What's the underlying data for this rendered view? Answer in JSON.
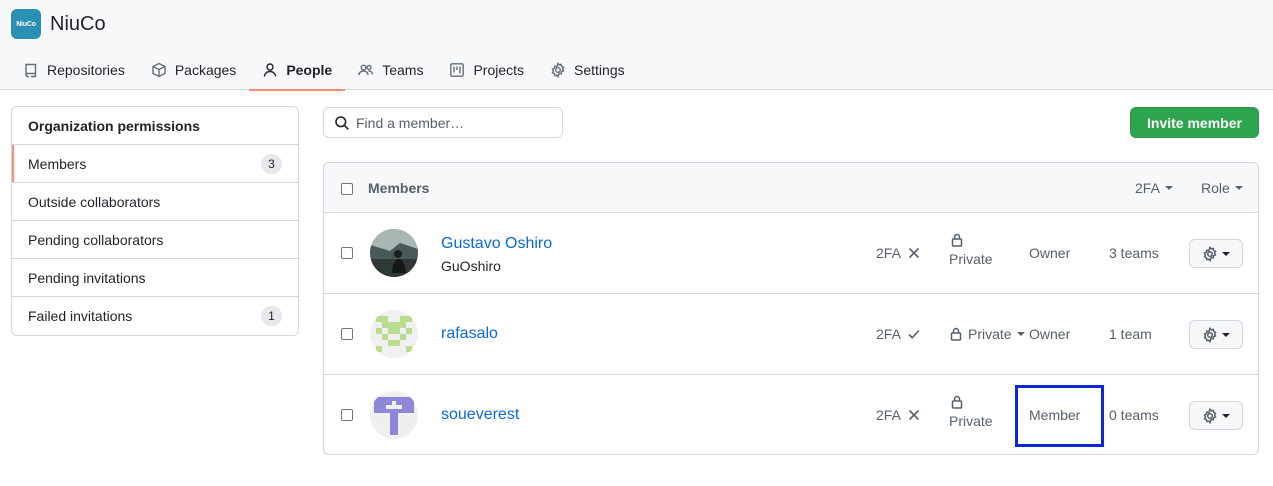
{
  "org": {
    "logo_text": "NiuCo",
    "name": "NiuCo",
    "logo_color": "#2b8fb3"
  },
  "tabs": [
    {
      "label": "Repositories",
      "icon": "repo-icon"
    },
    {
      "label": "Packages",
      "icon": "package-icon"
    },
    {
      "label": "People",
      "icon": "person-icon",
      "active": true
    },
    {
      "label": "Teams",
      "icon": "people-icon"
    },
    {
      "label": "Projects",
      "icon": "project-icon"
    },
    {
      "label": "Settings",
      "icon": "gear-icon"
    }
  ],
  "sidebar": {
    "title": "Organization permissions",
    "items": [
      {
        "label": "Members",
        "count": "3",
        "active": true
      },
      {
        "label": "Outside collaborators",
        "count": ""
      },
      {
        "label": "Pending collaborators",
        "count": ""
      },
      {
        "label": "Pending invitations",
        "count": ""
      },
      {
        "label": "Failed invitations",
        "count": "1"
      }
    ]
  },
  "search": {
    "placeholder": "Find a member…"
  },
  "invite_button": "Invite member",
  "members_table": {
    "title": "Members",
    "filter_2fa": "2FA",
    "filter_role": "Role",
    "rows": [
      {
        "name": "Gustavo Oshiro",
        "login": "GuOshiro",
        "twofa": "2FA",
        "twofa_status": "x-icon",
        "visibility": "Private",
        "role": "Owner",
        "teams": "3 teams"
      },
      {
        "name": "rafasalo",
        "login": "",
        "twofa": "2FA",
        "twofa_status": "check-icon",
        "visibility": "Private",
        "role": "Owner",
        "teams": "1 team"
      },
      {
        "name": "soueverest",
        "login": "",
        "twofa": "2FA",
        "twofa_status": "x-icon",
        "visibility": "Private",
        "role": "Member",
        "teams": "0 teams"
      }
    ]
  },
  "colors": {
    "accent_tab": "#fd8c73",
    "link": "#0969da",
    "invite_bg": "#2da44e",
    "highlight": "#0a28d6"
  }
}
